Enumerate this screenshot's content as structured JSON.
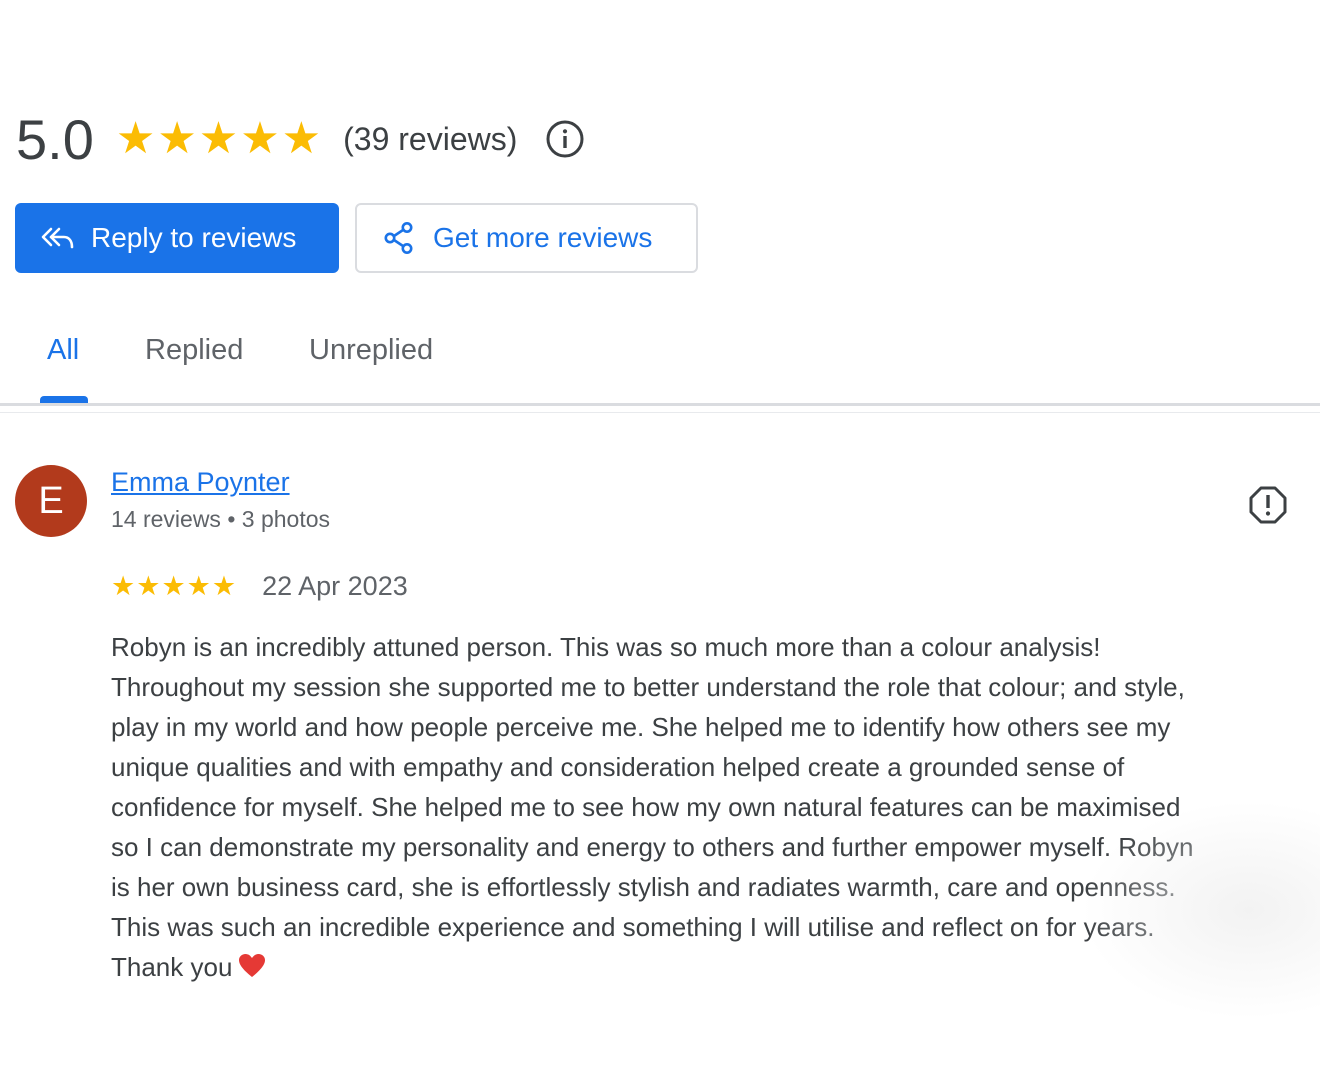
{
  "summary": {
    "score": "5.0",
    "stars": [
      "★",
      "★",
      "★",
      "★",
      "★"
    ],
    "review_count": "(39 reviews)",
    "info_icon": "info-icon"
  },
  "actions": {
    "reply_label": "Reply to reviews",
    "reply_icon": "reply-all-icon",
    "more_label": "Get more reviews",
    "more_icon": "share-icon"
  },
  "tabs": [
    {
      "label": "All",
      "active": true
    },
    {
      "label": "Replied",
      "active": false
    },
    {
      "label": "Unreplied",
      "active": false
    }
  ],
  "review": {
    "avatar_initial": "E",
    "name": "Emma Poynter",
    "meta": "14 reviews • 3 photos",
    "stars": [
      "★",
      "★",
      "★",
      "★",
      "★"
    ],
    "date": "22 Apr 2023",
    "lines": [
      "Robyn is an incredibly attuned person. This was so much more than a colour analysis!",
      "Throughout my session she supported me to better understand the role that colour; and style,",
      "play in my world and how people perceive me. She helped me to identify how others see my",
      "unique qualities and with empathy and consideration helped create a grounded sense of",
      "confidence for myself. She helped me to see how my own natural features can be maximised",
      "so I can demonstrate my personality and energy to others and further empower myself. Robyn",
      "is her own business card, she is effortlessly stylish and radiates warmth, care and openness.",
      "This was such an incredible experience and something I will utilise and reflect on for years.",
      "Thank you"
    ],
    "flag_icon": "report-icon"
  },
  "colors": {
    "accent": "#1a73e8",
    "star": "#fbbc04",
    "avatar": "#b23a1c",
    "heart": "#e53935"
  }
}
